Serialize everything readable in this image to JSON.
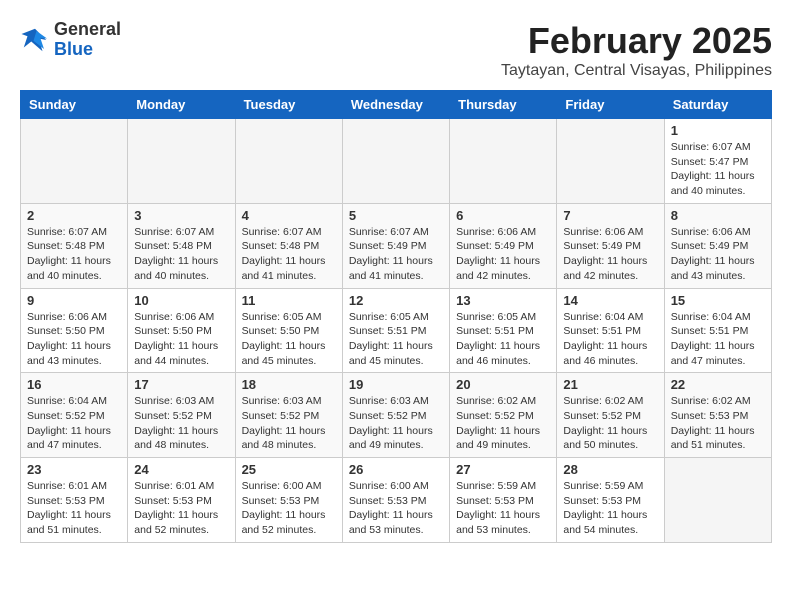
{
  "header": {
    "logo_general": "General",
    "logo_blue": "Blue",
    "month_title": "February 2025",
    "location": "Taytayan, Central Visayas, Philippines"
  },
  "calendar": {
    "days_of_week": [
      "Sunday",
      "Monday",
      "Tuesday",
      "Wednesday",
      "Thursday",
      "Friday",
      "Saturday"
    ],
    "weeks": [
      [
        {
          "day": "",
          "info": ""
        },
        {
          "day": "",
          "info": ""
        },
        {
          "day": "",
          "info": ""
        },
        {
          "day": "",
          "info": ""
        },
        {
          "day": "",
          "info": ""
        },
        {
          "day": "",
          "info": ""
        },
        {
          "day": "1",
          "info": "Sunrise: 6:07 AM\nSunset: 5:47 PM\nDaylight: 11 hours and 40 minutes."
        }
      ],
      [
        {
          "day": "2",
          "info": "Sunrise: 6:07 AM\nSunset: 5:48 PM\nDaylight: 11 hours and 40 minutes."
        },
        {
          "day": "3",
          "info": "Sunrise: 6:07 AM\nSunset: 5:48 PM\nDaylight: 11 hours and 40 minutes."
        },
        {
          "day": "4",
          "info": "Sunrise: 6:07 AM\nSunset: 5:48 PM\nDaylight: 11 hours and 41 minutes."
        },
        {
          "day": "5",
          "info": "Sunrise: 6:07 AM\nSunset: 5:49 PM\nDaylight: 11 hours and 41 minutes."
        },
        {
          "day": "6",
          "info": "Sunrise: 6:06 AM\nSunset: 5:49 PM\nDaylight: 11 hours and 42 minutes."
        },
        {
          "day": "7",
          "info": "Sunrise: 6:06 AM\nSunset: 5:49 PM\nDaylight: 11 hours and 42 minutes."
        },
        {
          "day": "8",
          "info": "Sunrise: 6:06 AM\nSunset: 5:49 PM\nDaylight: 11 hours and 43 minutes."
        }
      ],
      [
        {
          "day": "9",
          "info": "Sunrise: 6:06 AM\nSunset: 5:50 PM\nDaylight: 11 hours and 43 minutes."
        },
        {
          "day": "10",
          "info": "Sunrise: 6:06 AM\nSunset: 5:50 PM\nDaylight: 11 hours and 44 minutes."
        },
        {
          "day": "11",
          "info": "Sunrise: 6:05 AM\nSunset: 5:50 PM\nDaylight: 11 hours and 45 minutes."
        },
        {
          "day": "12",
          "info": "Sunrise: 6:05 AM\nSunset: 5:51 PM\nDaylight: 11 hours and 45 minutes."
        },
        {
          "day": "13",
          "info": "Sunrise: 6:05 AM\nSunset: 5:51 PM\nDaylight: 11 hours and 46 minutes."
        },
        {
          "day": "14",
          "info": "Sunrise: 6:04 AM\nSunset: 5:51 PM\nDaylight: 11 hours and 46 minutes."
        },
        {
          "day": "15",
          "info": "Sunrise: 6:04 AM\nSunset: 5:51 PM\nDaylight: 11 hours and 47 minutes."
        }
      ],
      [
        {
          "day": "16",
          "info": "Sunrise: 6:04 AM\nSunset: 5:52 PM\nDaylight: 11 hours and 47 minutes."
        },
        {
          "day": "17",
          "info": "Sunrise: 6:03 AM\nSunset: 5:52 PM\nDaylight: 11 hours and 48 minutes."
        },
        {
          "day": "18",
          "info": "Sunrise: 6:03 AM\nSunset: 5:52 PM\nDaylight: 11 hours and 48 minutes."
        },
        {
          "day": "19",
          "info": "Sunrise: 6:03 AM\nSunset: 5:52 PM\nDaylight: 11 hours and 49 minutes."
        },
        {
          "day": "20",
          "info": "Sunrise: 6:02 AM\nSunset: 5:52 PM\nDaylight: 11 hours and 49 minutes."
        },
        {
          "day": "21",
          "info": "Sunrise: 6:02 AM\nSunset: 5:52 PM\nDaylight: 11 hours and 50 minutes."
        },
        {
          "day": "22",
          "info": "Sunrise: 6:02 AM\nSunset: 5:53 PM\nDaylight: 11 hours and 51 minutes."
        }
      ],
      [
        {
          "day": "23",
          "info": "Sunrise: 6:01 AM\nSunset: 5:53 PM\nDaylight: 11 hours and 51 minutes."
        },
        {
          "day": "24",
          "info": "Sunrise: 6:01 AM\nSunset: 5:53 PM\nDaylight: 11 hours and 52 minutes."
        },
        {
          "day": "25",
          "info": "Sunrise: 6:00 AM\nSunset: 5:53 PM\nDaylight: 11 hours and 52 minutes."
        },
        {
          "day": "26",
          "info": "Sunrise: 6:00 AM\nSunset: 5:53 PM\nDaylight: 11 hours and 53 minutes."
        },
        {
          "day": "27",
          "info": "Sunrise: 5:59 AM\nSunset: 5:53 PM\nDaylight: 11 hours and 53 minutes."
        },
        {
          "day": "28",
          "info": "Sunrise: 5:59 AM\nSunset: 5:53 PM\nDaylight: 11 hours and 54 minutes."
        },
        {
          "day": "",
          "info": ""
        }
      ]
    ]
  }
}
